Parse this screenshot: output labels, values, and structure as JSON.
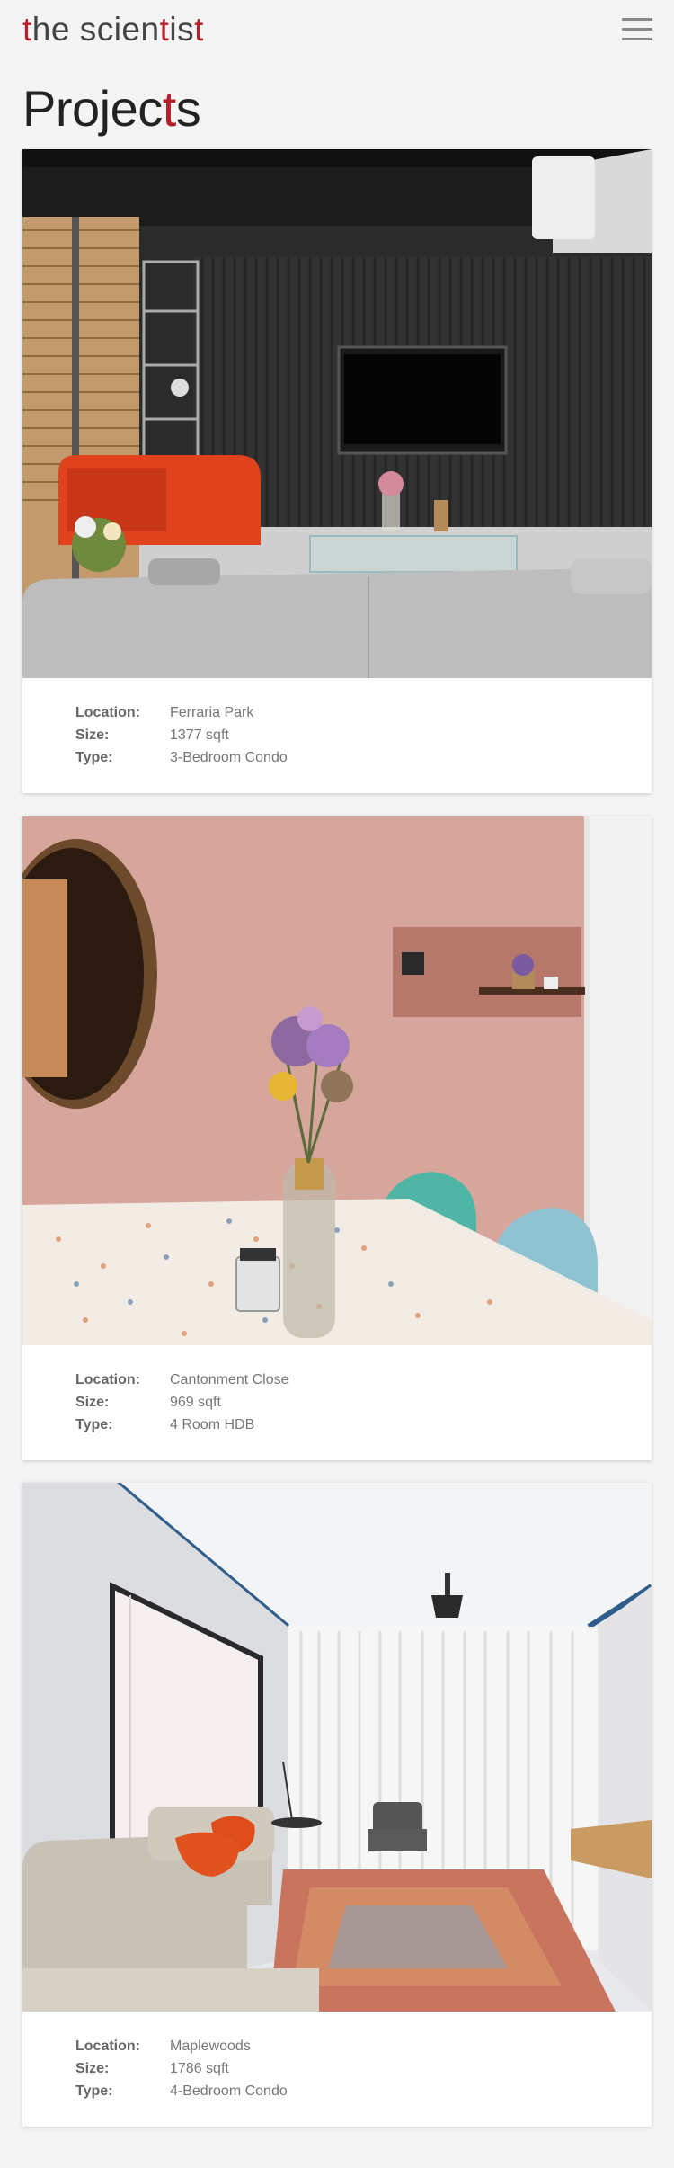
{
  "header": {
    "logo": {
      "part1": "t",
      "part2": "he scien",
      "part3": "t",
      "part4": "is",
      "part5": "t"
    },
    "menu_icon": "hamburger-icon"
  },
  "page": {
    "title_a": "Projec",
    "title_b": "t",
    "title_c": "s",
    "accent_color": "#b51f2a"
  },
  "labels": {
    "location": "Location:",
    "size": "Size:",
    "type": "Type:"
  },
  "projects": [
    {
      "location": "Ferraria Park",
      "size": "1377 sqft",
      "type": "3-Bedroom Condo"
    },
    {
      "location": "Cantonment Close",
      "size": "969 sqft",
      "type": "4 Room HDB"
    },
    {
      "location": "Maplewoods",
      "size": "1786 sqft",
      "type": "4-Bedroom Condo"
    }
  ]
}
